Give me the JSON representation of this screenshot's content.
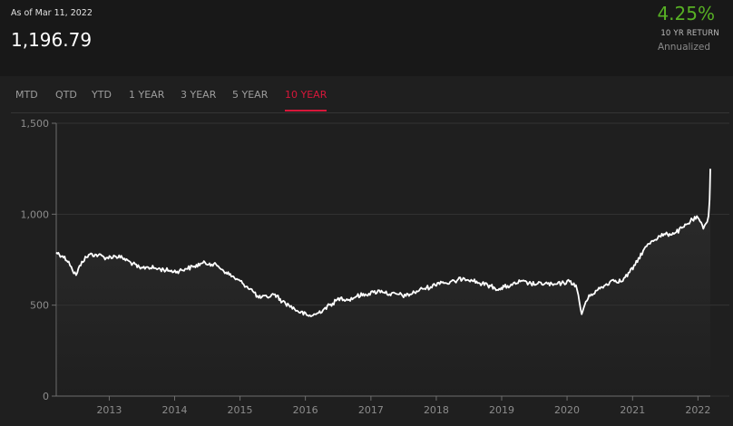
{
  "header": {
    "as_of": "As of Mar 11, 2022",
    "value": "1,196.79",
    "return_pct": "4.25%",
    "return_label": "10 YR RETURN",
    "return_sub": "Annualized"
  },
  "tabs": [
    {
      "label": "MTD",
      "active": false
    },
    {
      "label": "QTD",
      "active": false
    },
    {
      "label": "YTD",
      "active": false
    },
    {
      "label": "1 YEAR",
      "active": false
    },
    {
      "label": "3 YEAR",
      "active": false
    },
    {
      "label": "5 YEAR",
      "active": false
    },
    {
      "label": "10 YEAR",
      "active": true
    }
  ],
  "colors": {
    "background": "#1b1b1b",
    "line": "#ffffff",
    "positive": "#57b024",
    "active_tab": "#d7173a"
  },
  "chart_data": {
    "type": "line",
    "title": "",
    "xlabel": "",
    "ylabel": "",
    "ylim": [
      0,
      1500
    ],
    "xlim": [
      "2012-03-11",
      "2022-03-11"
    ],
    "y_ticks": [
      "0",
      "500",
      "1,000",
      "1,500"
    ],
    "y_tick_values": [
      0,
      500,
      1000,
      1500
    ],
    "x_ticks": [
      "2013",
      "2014",
      "2015",
      "2016",
      "2017",
      "2018",
      "2019",
      "2020",
      "2021",
      "2022"
    ],
    "grid": true,
    "series": [
      {
        "x": [
          "2012-03-11",
          "2012-04-15",
          "2012-05-20",
          "2012-06-10",
          "2012-06-30",
          "2012-08-01",
          "2012-09-15",
          "2012-11-01",
          "2012-12-15",
          "2013-02-01",
          "2013-03-15",
          "2013-05-01",
          "2013-06-24",
          "2013-08-01",
          "2013-10-01",
          "2013-12-01",
          "2014-01-15",
          "2014-03-01",
          "2014-04-15",
          "2014-06-01",
          "2014-07-15",
          "2014-09-01",
          "2014-10-15",
          "2014-12-01",
          "2015-01-15",
          "2015-03-01",
          "2015-04-15",
          "2015-06-01",
          "2015-07-15",
          "2015-08-25",
          "2015-10-01",
          "2015-11-15",
          "2016-01-20",
          "2016-03-01",
          "2016-04-15",
          "2016-06-01",
          "2016-07-15",
          "2016-09-01",
          "2016-10-15",
          "2016-12-01",
          "2017-01-15",
          "2017-03-01",
          "2017-04-15",
          "2017-06-01",
          "2017-07-15",
          "2017-09-01",
          "2017-10-15",
          "2017-12-01",
          "2018-01-26",
          "2018-03-01",
          "2018-04-15",
          "2018-06-01",
          "2018-07-15",
          "2018-09-01",
          "2018-10-15",
          "2018-12-24",
          "2019-01-15",
          "2019-03-01",
          "2019-04-15",
          "2019-06-01",
          "2019-07-15",
          "2019-09-01",
          "2019-10-15",
          "2019-12-01",
          "2020-01-15",
          "2020-02-20",
          "2020-03-23",
          "2020-04-15",
          "2020-05-15",
          "2020-06-15",
          "2020-08-01",
          "2020-09-15",
          "2020-11-01",
          "2020-12-15",
          "2021-01-15",
          "2021-03-01",
          "2021-04-15",
          "2021-06-01",
          "2021-07-15",
          "2021-09-01",
          "2021-10-15",
          "2021-12-01",
          "2022-01-01",
          "2022-01-31",
          "2022-02-15",
          "2022-03-01",
          "2022-03-07",
          "2022-03-11"
        ],
        "y": [
          790,
          770,
          740,
          690,
          665,
          740,
          780,
          775,
          760,
          770,
          760,
          735,
          700,
          710,
          700,
          690,
          685,
          700,
          710,
          730,
          730,
          715,
          680,
          650,
          620,
          590,
          540,
          545,
          560,
          520,
          500,
          470,
          440,
          450,
          480,
          510,
          540,
          530,
          550,
          560,
          570,
          580,
          560,
          560,
          550,
          570,
          590,
          600,
          630,
          620,
          630,
          650,
          640,
          620,
          610,
          585,
          600,
          610,
          630,
          620,
          615,
          620,
          610,
          620,
          630,
          610,
          450,
          520,
          560,
          580,
          610,
          640,
          630,
          680,
          720,
          800,
          850,
          880,
          890,
          900,
          930,
          970,
          980,
          920,
          950,
          990,
          1080,
          1250
        ]
      }
    ]
  }
}
